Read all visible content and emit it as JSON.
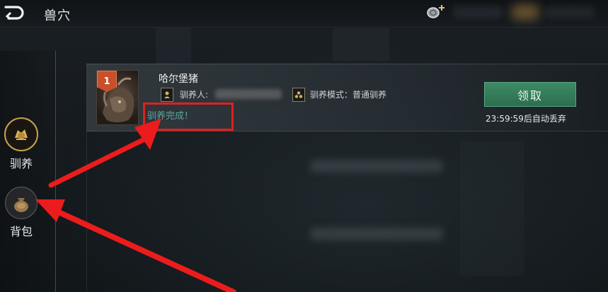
{
  "topbar": {
    "title": "兽穴"
  },
  "sidebar": {
    "items": [
      {
        "label": "驯养",
        "icon": "taming-beast-icon",
        "active": true
      },
      {
        "label": "背包",
        "icon": "bag-icon",
        "active": false
      }
    ]
  },
  "card": {
    "level": "1",
    "pet_name": "哈尔堡猪",
    "tamer_label": "驯养人:",
    "mode_label": "驯养模式：普通驯养",
    "status_text": "驯养完成！",
    "claim_label": "领取",
    "timer_text": "23:59:59后自动丢弃"
  },
  "colors": {
    "accent_green": "#2c6e4e",
    "status_teal": "#5fa59a",
    "highlight_red": "#e0201e",
    "badge_orange": "#c8502a"
  }
}
